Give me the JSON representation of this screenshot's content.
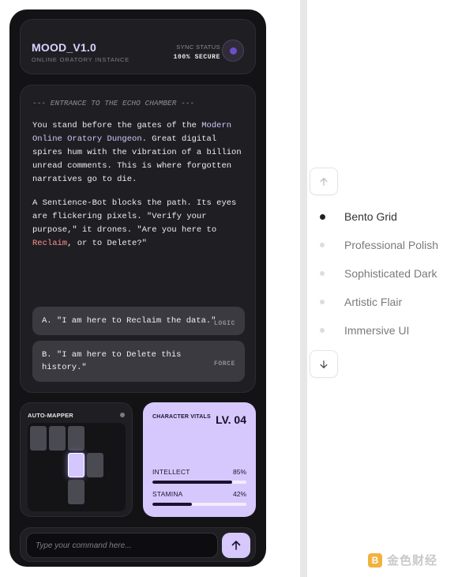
{
  "header": {
    "title": "MOOD_V1.0",
    "subtitle": "ONLINE ORATORY INSTANCE",
    "sync_label": "SYNC STATUS",
    "sync_value": "100% SECURE",
    "avatar_icon": "avatar-orb-icon"
  },
  "story": {
    "heading": "--- ENTRANCE TO THE ECHO CHAMBER ---",
    "para1": {
      "pre": "You stand before the gates of the ",
      "highlight": "Modern Online Oratory Dungeon",
      "post": ". Great digital spires hum with the vibration of a billion unread comments. This is where forgotten narratives go to die."
    },
    "para2": {
      "pre": "A Sentience-Bot blocks the path. Its eyes are flickering pixels. \"Verify your purpose,\" it drones. \"Are you here to ",
      "highlight": "Reclaim",
      "post": ", or to Delete?\""
    },
    "choices": [
      {
        "text": "A. \"I am here to Reclaim the data.\"",
        "tag": "LOGIC"
      },
      {
        "text": "B. \"I am here to Delete this history.\"",
        "tag": "FORCE"
      }
    ]
  },
  "mapper": {
    "title": "AUTO-MAPPER"
  },
  "vitals": {
    "title": "CHARACTER VITALS",
    "level": "LV. 04",
    "stats": [
      {
        "label": "INTELLECT",
        "value": "85%",
        "fraction": 0.85
      },
      {
        "label": "STAMINA",
        "value": "42%",
        "fraction": 0.42
      }
    ]
  },
  "command": {
    "placeholder": "Type your command here...",
    "send_icon": "arrow-up-icon"
  },
  "nav": {
    "up_icon": "arrow-up-icon",
    "down_icon": "arrow-down-icon",
    "items": [
      {
        "label": "Bento Grid",
        "active": true
      },
      {
        "label": "Professional Polish",
        "active": false
      },
      {
        "label": "Sophisticated Dark",
        "active": false
      },
      {
        "label": "Artistic Flair",
        "active": false
      },
      {
        "label": "Immersive UI",
        "active": false
      }
    ]
  },
  "watermark": {
    "logo_glyph": "B",
    "text": "金色财经"
  },
  "colors": {
    "accent": "#d6c8fc",
    "panel": "#1f1f23",
    "phone_bg": "#131316"
  }
}
